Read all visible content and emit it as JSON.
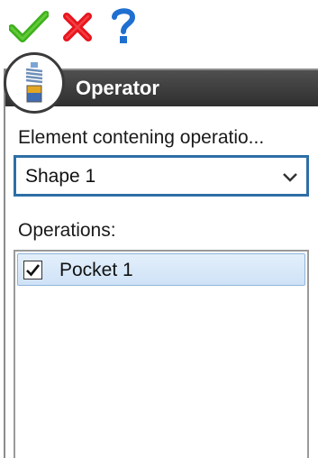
{
  "toolbar": {
    "ok_icon": "checkmark-icon",
    "cancel_icon": "x-icon",
    "help_icon": "question-icon",
    "colors": {
      "ok": "#3db01c",
      "cancel": "#e8141d",
      "help": "#1f6fd1"
    }
  },
  "panel": {
    "title": "Operator",
    "icon": "spring-icon",
    "element_label": "Element  contening operatio...",
    "element_select": {
      "value": "Shape 1"
    },
    "operations_label": "Operations:",
    "operations": [
      {
        "label": "Pocket 1",
        "checked": true
      }
    ],
    "accent": "#2e6fa6"
  }
}
